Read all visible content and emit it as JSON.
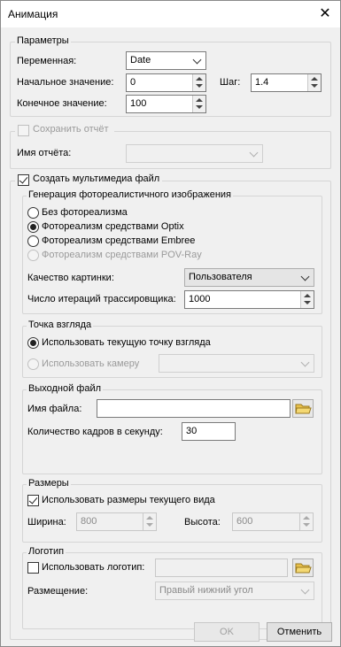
{
  "window": {
    "title": "Анимация",
    "close_glyph": "✕"
  },
  "params": {
    "legend": "Параметры",
    "variable_label": "Переменная:",
    "variable_value": "Date",
    "start_label": "Начальное значение:",
    "start_value": "0",
    "step_label": "Шаг:",
    "step_value": "1.4",
    "end_label": "Конечное значение:",
    "end_value": "100"
  },
  "report": {
    "save_label": "Сохранить отчёт",
    "name_label": "Имя отчёта:",
    "name_value": ""
  },
  "multimedia": {
    "create_label": "Создать мультимедиа файл",
    "photo": {
      "legend": "Генерация фотореалистичного изображения",
      "options": [
        "Без фотореализма",
        "Фотореализм средствами Optix",
        "Фотореализм средствами Embree",
        "Фотореализм средствами POV-Ray"
      ],
      "quality_label": "Качество картинки:",
      "quality_value": "Пользователя",
      "iter_label": "Число итераций трассировщика:",
      "iter_value": "1000"
    },
    "viewpoint": {
      "legend": "Точка взгляда",
      "current_label": "Использовать текущую точку взгляда",
      "camera_label": "Использовать камеру",
      "camera_value": ""
    },
    "output": {
      "legend": "Выходной файл",
      "filename_label": "Имя файла:",
      "filename_value": "",
      "fps_label": "Количество кадров в секунду:",
      "fps_value": "30"
    },
    "size": {
      "legend": "Размеры",
      "use_current_label": "Использовать размеры текущего вида",
      "width_label": "Ширина:",
      "width_value": "800",
      "height_label": "Высота:",
      "height_value": "600"
    },
    "logo": {
      "legend": "Логотип",
      "use_logo_label": "Использовать логотип:",
      "logo_value": "",
      "placement_label": "Размещение:",
      "placement_value": "Правый нижний угол"
    }
  },
  "buttons": {
    "ok": "OK",
    "cancel": "Отменить"
  },
  "colors": {
    "window_bg": "#f0f0f0",
    "group_border": "#d5d5d5",
    "disabled_text": "#9a9a9a"
  },
  "icons": [
    "close-icon",
    "chevron-down-icon",
    "spin-up-icon",
    "spin-down-icon",
    "folder-icon"
  ]
}
